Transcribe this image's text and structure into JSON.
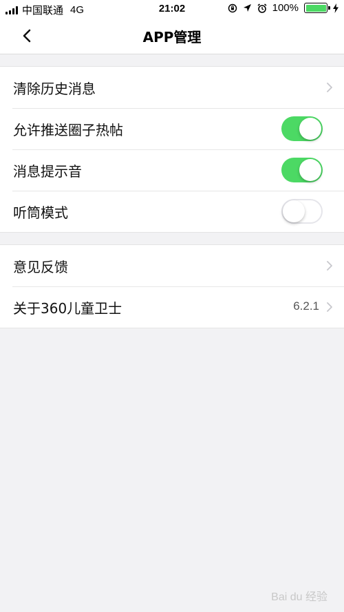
{
  "status_bar": {
    "carrier": "中国联通",
    "network": "4G",
    "time": "21:02",
    "battery": "100%",
    "battery_level": 1.0,
    "icons": [
      "rotation-lock-icon",
      "location-arrow-icon",
      "alarm-icon"
    ]
  },
  "nav": {
    "title": "APP管理",
    "back_icon": "chevron-left-icon"
  },
  "settings": {
    "group1": [
      {
        "label": "清除历史消息",
        "type": "link"
      },
      {
        "label": "允许推送圈子热帖",
        "type": "toggle",
        "on": true
      },
      {
        "label": "消息提示音",
        "type": "toggle",
        "on": true
      },
      {
        "label": "听筒模式",
        "type": "toggle",
        "on": false
      }
    ],
    "group2": [
      {
        "label": "意见反馈",
        "type": "link"
      },
      {
        "label": "关于360儿童卫士",
        "type": "link",
        "value": "6.2.1"
      }
    ]
  },
  "colors": {
    "toggle_on": "#4cd964",
    "background": "#f2f2f4"
  },
  "watermark": "Bai du 经验"
}
